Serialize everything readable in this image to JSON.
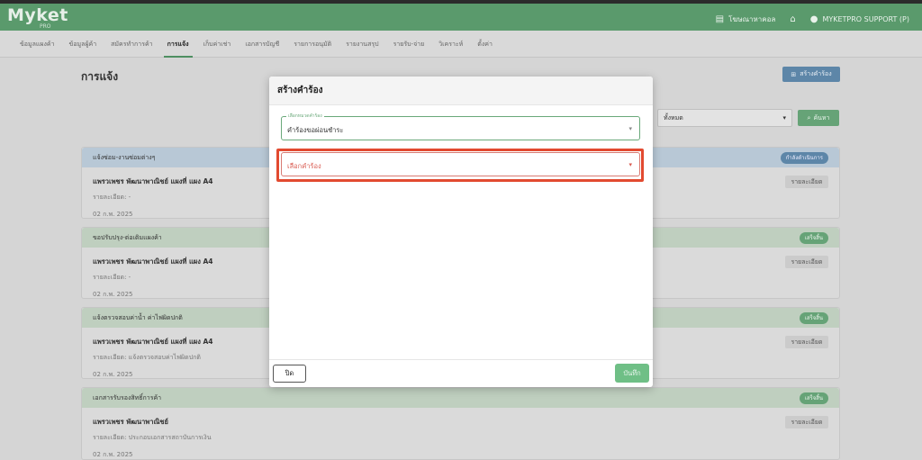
{
  "app": {
    "logo": "Myket",
    "logo_sub": "PRO"
  },
  "top_right": {
    "news_label": "โฆษณาหาคอล",
    "user_label": "MYKETPRO SUPPORT (P)"
  },
  "nav": {
    "items": [
      "ข้อมูลแผงค้า",
      "ข้อมูลผู้ค้า",
      "สมัครทำการค้า",
      "การแจ้ง",
      "เก็บค่าเช่า",
      "เอกสารบัญชี",
      "รายการอนุมัติ",
      "รายงานสรุป",
      "รายรับ-จ่าย",
      "วิเคราะห์",
      "ตั้งค่า"
    ],
    "active_index": 3
  },
  "page": {
    "title": "การแจ้ง",
    "create_button": "สร้างคำร้อง",
    "filter_value": "ทั้งหมด",
    "search_button": "ค้นหา"
  },
  "cards": [
    {
      "header": "แจ้งซ่อม-งานซ่อมต่างๆ",
      "badge": "กำลังดำเนินการ",
      "shop": "แพรวเพชร พัฒนาพาณิชย์ แผงที่ แผง A4",
      "detail": "รายละเอียด: -",
      "date": "02 ก.พ. 2025",
      "detail_button": "รายละเอียด"
    },
    {
      "header": "ขอปรับปรุง-ต่อเติมแผงค้า",
      "badge": "เสร็จสิ้น",
      "shop": "แพรวเพชร พัฒนาพาณิชย์ แผงที่ แผง A4",
      "detail": "รายละเอียด: -",
      "date": "02 ก.พ. 2025",
      "detail_button": "รายละเอียด"
    },
    {
      "header": "แจ้งตรวจสอบค่าน้ำ ค่าไฟผิดปกติ",
      "badge": "เสร็จสิ้น",
      "shop": "แพรวเพชร พัฒนาพาณิชย์ แผงที่ แผง A4",
      "detail": "รายละเอียด: แจ้งตรวจสอบค่าไฟผิดปกติ",
      "date": "02 ก.พ. 2025",
      "detail_button": "รายละเอียด"
    },
    {
      "header": "เอกสารรับรองสิทธิ์การค้า",
      "badge": "เสร็จสิ้น",
      "shop": "แพรวเพชร พัฒนาพาณิชย์",
      "detail": "รายละเอียด: ประกอบเอกสารสถาบันการเงิน",
      "date": "02 ก.พ. 2025",
      "detail_button": "รายละเอียด"
    }
  ],
  "modal": {
    "title": "สร้างคำร้อง",
    "category_label": "เลือกหมวดคำร้อง",
    "category_value": "คำร้องขอผ่อนชำระ",
    "request_placeholder": "เลือกคำร้อง",
    "close_button": "ปิด",
    "save_button": "บันทึก"
  },
  "colors": {
    "primary": "#5a9a6c",
    "highlight": "#e24a30",
    "save": "#6fbf86"
  }
}
